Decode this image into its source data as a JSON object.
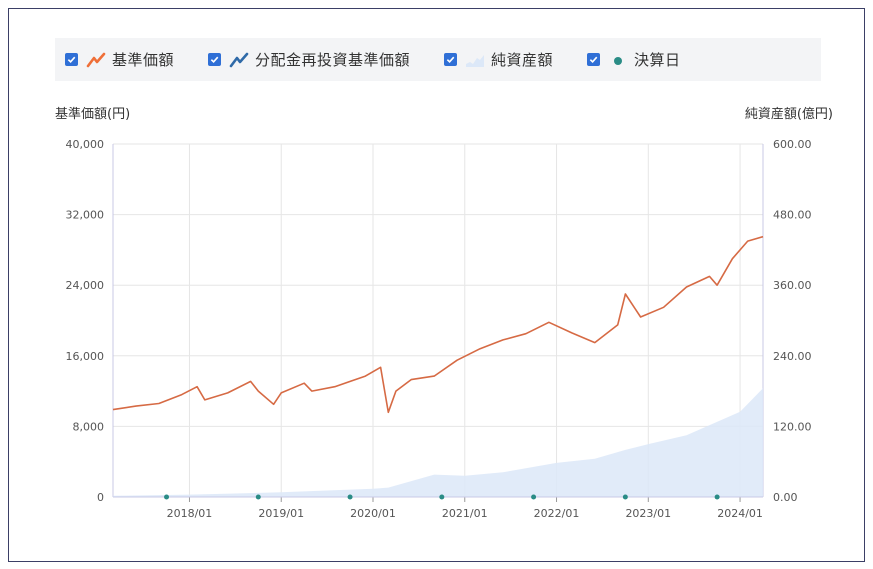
{
  "legend": [
    {
      "label": "基準価額",
      "icon": "line-orange-icon",
      "color": "#ef6f38",
      "checked": true
    },
    {
      "label": "分配金再投資基準価額",
      "icon": "line-blue-icon",
      "color": "#2f6aa8",
      "checked": true
    },
    {
      "label": "純資産額",
      "icon": "area-icon",
      "color": "#dce8f8",
      "checked": true
    },
    {
      "label": "決算日",
      "icon": "dot-teal-icon",
      "color": "#2a8c86",
      "checked": true
    }
  ],
  "chart_data": {
    "type": "line",
    "left_axis_title": "基準価額(円)",
    "right_axis_title": "純資産額(億円)",
    "y_left_ticks": [
      "40,000",
      "32,000",
      "24,000",
      "16,000",
      "8,000",
      "0"
    ],
    "y_left_range": [
      0,
      40000
    ],
    "y_right_ticks": [
      "600.00",
      "480.00",
      "360.00",
      "240.00",
      "120.00",
      "0.00"
    ],
    "y_right_range": [
      0,
      600
    ],
    "x_ticks": [
      "2018/01",
      "2019/01",
      "2020/01",
      "2021/01",
      "2022/01",
      "2023/01",
      "2024/01"
    ],
    "x_range": [
      "2017/03",
      "2024/04"
    ],
    "grid": true,
    "series": [
      {
        "name": "基準価額",
        "color": "#d66a44",
        "points": [
          [
            "2017/03",
            9900
          ],
          [
            "2017/06",
            10300
          ],
          [
            "2017/09",
            10600
          ],
          [
            "2017/12",
            11600
          ],
          [
            "2018/02",
            12500
          ],
          [
            "2018/03",
            11000
          ],
          [
            "2018/06",
            11800
          ],
          [
            "2018/09",
            13100
          ],
          [
            "2018/10",
            12000
          ],
          [
            "2018/12",
            10500
          ],
          [
            "2019/01",
            11800
          ],
          [
            "2019/04",
            12900
          ],
          [
            "2019/05",
            12000
          ],
          [
            "2019/08",
            12500
          ],
          [
            "2019/12",
            13700
          ],
          [
            "2020/02",
            14700
          ],
          [
            "2020/03",
            9600
          ],
          [
            "2020/04",
            12000
          ],
          [
            "2020/06",
            13300
          ],
          [
            "2020/09",
            13700
          ],
          [
            "2020/12",
            15500
          ],
          [
            "2021/03",
            16800
          ],
          [
            "2021/06",
            17800
          ],
          [
            "2021/09",
            18500
          ],
          [
            "2021/12",
            19800
          ],
          [
            "2022/03",
            18600
          ],
          [
            "2022/06",
            17500
          ],
          [
            "2022/09",
            19500
          ],
          [
            "2022/10",
            23000
          ],
          [
            "2022/12",
            20400
          ],
          [
            "2023/03",
            21500
          ],
          [
            "2023/06",
            23800
          ],
          [
            "2023/09",
            25000
          ],
          [
            "2023/10",
            24000
          ],
          [
            "2023/12",
            27000
          ],
          [
            "2024/02",
            29000
          ],
          [
            "2024/04",
            29500
          ]
        ]
      },
      {
        "name": "純資産額",
        "color": "#dce8f8",
        "points": [
          [
            "2017/03",
            2
          ],
          [
            "2018/01",
            4
          ],
          [
            "2019/01",
            8
          ],
          [
            "2020/01",
            14
          ],
          [
            "2020/03",
            16
          ],
          [
            "2020/09",
            38
          ],
          [
            "2021/01",
            36
          ],
          [
            "2021/06",
            42
          ],
          [
            "2022/01",
            58
          ],
          [
            "2022/06",
            65
          ],
          [
            "2022/10",
            80
          ],
          [
            "2023/01",
            90
          ],
          [
            "2023/06",
            105
          ],
          [
            "2024/01",
            145
          ],
          [
            "2024/04",
            185
          ]
        ]
      }
    ],
    "settlement_dates": [
      "2017/10",
      "2018/10",
      "2019/10",
      "2020/10",
      "2021/10",
      "2022/10",
      "2023/10"
    ]
  }
}
